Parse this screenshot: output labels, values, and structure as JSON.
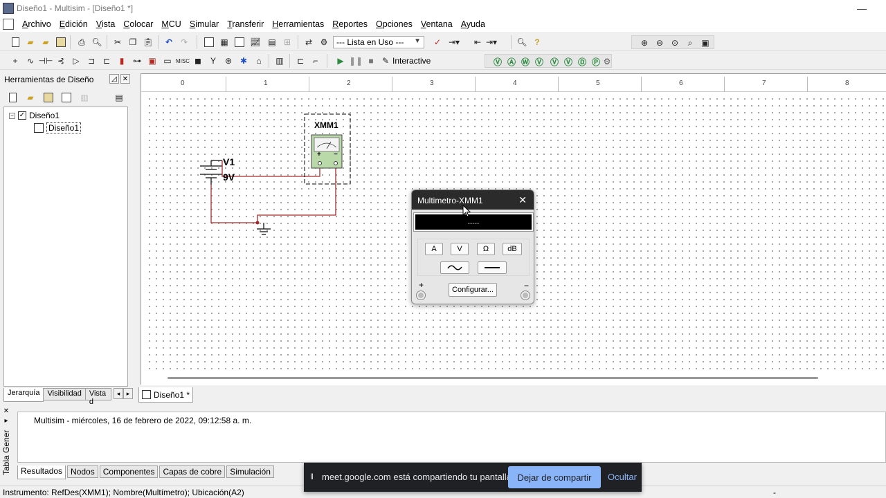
{
  "window": {
    "title": "Diseño1 - Multisim - [Diseño1 *]"
  },
  "menu": [
    "Archivo",
    "Edición",
    "Vista",
    "Colocar",
    "MCU",
    "Simular",
    "Transferir",
    "Herramientas",
    "Reportes",
    "Opciones",
    "Ventana",
    "Ayuda"
  ],
  "toolbar": {
    "in_use_list": "--- Lista en Uso ---",
    "interactive_label": "Interactive"
  },
  "design_toolbox": {
    "title": "Herramientas de Diseño",
    "tree": {
      "root": "Diseño1",
      "child": "Diseño1"
    },
    "tabs": [
      "Jerarquía",
      "Visibilidad",
      "Vista d"
    ]
  },
  "ruler": {
    "marks": [
      "0",
      "1",
      "2",
      "3",
      "4",
      "5",
      "6",
      "7",
      "8"
    ]
  },
  "schematic": {
    "source_ref": "V1",
    "source_value": "9V",
    "instrument_ref": "XMM1"
  },
  "document_tab": "Diseño1 *",
  "multimeter": {
    "title": "Multimetro-XMM1",
    "display": "-----",
    "mode_buttons": [
      "A",
      "V",
      "Ω",
      "dB"
    ],
    "settings_button": "Configurar...",
    "plus_label": "+",
    "minus_label": "−"
  },
  "spreadsheet": {
    "panel_title": "Tabla Gener",
    "result_line": "Multisim  -  miércoles, 16 de febrero de 2022, 09:12:58 a. m.",
    "tabs": [
      "Resultados",
      "Nodos",
      "Componentes",
      "Capas de cobre",
      "Simulación"
    ]
  },
  "status_bar": {
    "text": "Instrumento: RefDes(XMM1); Nombre(Multímetro); Ubicación(A2)",
    "right": "-"
  },
  "share_bar": {
    "message": "meet.google.com está compartiendo tu pantalla.",
    "stop_label": "Dejar de compartir",
    "hide_label": "Ocultar"
  },
  "colors": {
    "wire": "#a52a2a",
    "share_button": "#8ab4f8",
    "instrument_body": "#b9d9a9"
  }
}
